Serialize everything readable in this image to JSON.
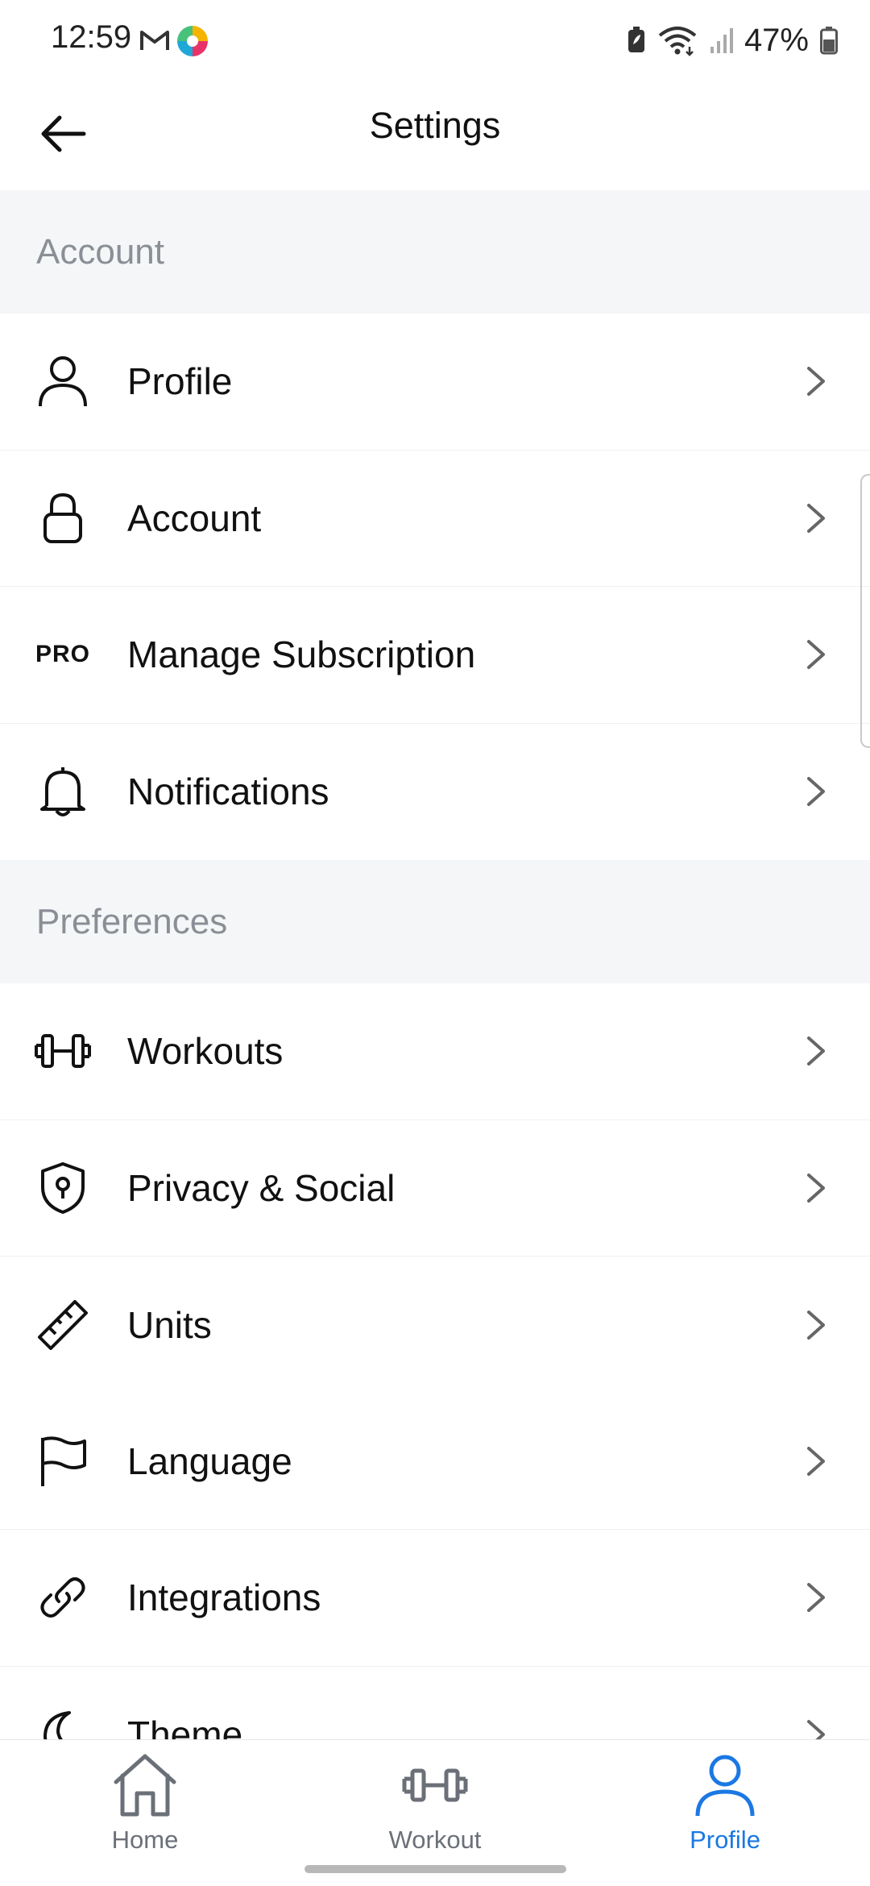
{
  "status_bar": {
    "time": "12:59",
    "battery_percent": "47%",
    "icons": [
      "gmail-icon",
      "app-icon",
      "battery-saver-icon",
      "wifi-icon",
      "signal-icon",
      "battery-icon"
    ]
  },
  "header": {
    "title": "Settings",
    "back_icon": "arrow-left-icon"
  },
  "sections": [
    {
      "title": "Account",
      "items": [
        {
          "label": "Profile",
          "icon": "user-icon"
        },
        {
          "label": "Account",
          "icon": "lock-icon"
        },
        {
          "label": "Manage Subscription",
          "icon": "pro-badge-icon",
          "icon_text": "PRO"
        },
        {
          "label": "Notifications",
          "icon": "bell-icon"
        }
      ]
    },
    {
      "title": "Preferences",
      "items": [
        {
          "label": "Workouts",
          "icon": "dumbbell-icon"
        },
        {
          "label": "Privacy & Social",
          "icon": "shield-lock-icon"
        },
        {
          "label": "Units",
          "icon": "ruler-icon"
        },
        {
          "label": "Language",
          "icon": "flag-icon"
        },
        {
          "label": "Integrations",
          "icon": "link-icon"
        },
        {
          "label": "Theme",
          "icon": "moon-icon"
        }
      ]
    }
  ],
  "bottom_nav": {
    "items": [
      {
        "label": "Home",
        "icon": "home-icon",
        "active": false
      },
      {
        "label": "Workout",
        "icon": "dumbbell-icon",
        "active": false
      },
      {
        "label": "Profile",
        "icon": "user-icon",
        "active": true
      }
    ],
    "active_color": "#1b78e3",
    "inactive_color": "#6b7078"
  },
  "colors": {
    "section_bg": "#f5f6f8",
    "section_text": "#8a8f96",
    "accent": "#1b78e3"
  }
}
